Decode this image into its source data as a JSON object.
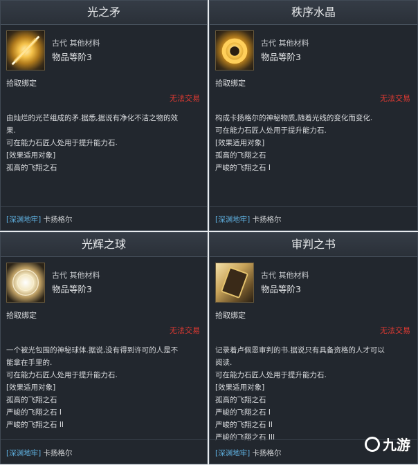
{
  "cards": [
    {
      "title": "光之矛",
      "icon": "light-spear-icon",
      "category": "古代 其他材料",
      "grade": "物品等阶3",
      "bind": "拾取绑定",
      "no_trade": "无法交易",
      "desc": [
        "由灿烂的光芒组成的矛.据悉,据说有净化不洁之物的效",
        "果.",
        "可在能力石匠人处用于提升能力石.",
        "[效果适用对象]",
        "孤高的飞翔之石"
      ],
      "source_link": "[深渊地牢]",
      "source_name": "卡扬格尔"
    },
    {
      "title": "秩序水晶",
      "icon": "order-crystal-icon",
      "category": "古代 其他材料",
      "grade": "物品等阶3",
      "bind": "拾取绑定",
      "no_trade": "无法交易",
      "desc": [
        "构成卡扬格尔的神秘物质,随着光线的变化而变化.",
        "可在能力石匠人处用于提升能力石.",
        "[效果适用对象]",
        "孤高的飞翔之石",
        "严峻的飞翔之石 I"
      ],
      "source_link": "[深渊地牢]",
      "source_name": "卡扬格尔"
    },
    {
      "title": "光辉之球",
      "icon": "radiant-orb-icon",
      "category": "古代 其他材料",
      "grade": "物品等阶3",
      "bind": "拾取绑定",
      "no_trade": "无法交易",
      "desc": [
        "一个被光包围的神秘球体.据说,没有得到许可的人是不",
        "能拿在手里的.",
        "可在能力石匠人处用于提升能力石.",
        "[效果适用对象]",
        "孤高的飞翔之石",
        "严峻的飞翔之石 I",
        "严峻的飞翔之石 II"
      ],
      "source_link": "[深渊地牢]",
      "source_name": "卡扬格尔"
    },
    {
      "title": "审判之书",
      "icon": "judgment-book-icon",
      "category": "古代 其他材料",
      "grade": "物品等阶3",
      "bind": "拾取绑定",
      "no_trade": "无法交易",
      "desc": [
        "记录着卢佩恩审判的书.据说只有具备资格的人才可以",
        "阅读.",
        "可在能力石匠人处用于提升能力石.",
        "[效果适用对象]",
        "孤高的飞翔之石",
        "严峻的飞翔之石 I",
        "严峻的飞翔之石 II",
        "严峻的飞翔之石 III"
      ],
      "source_link": "[深渊地牢]",
      "source_name": "卡扬格尔"
    }
  ],
  "watermark": "九游",
  "colors": {
    "no_trade": "#e23a32",
    "link": "#5fb0e0",
    "panel": "#22272e"
  }
}
